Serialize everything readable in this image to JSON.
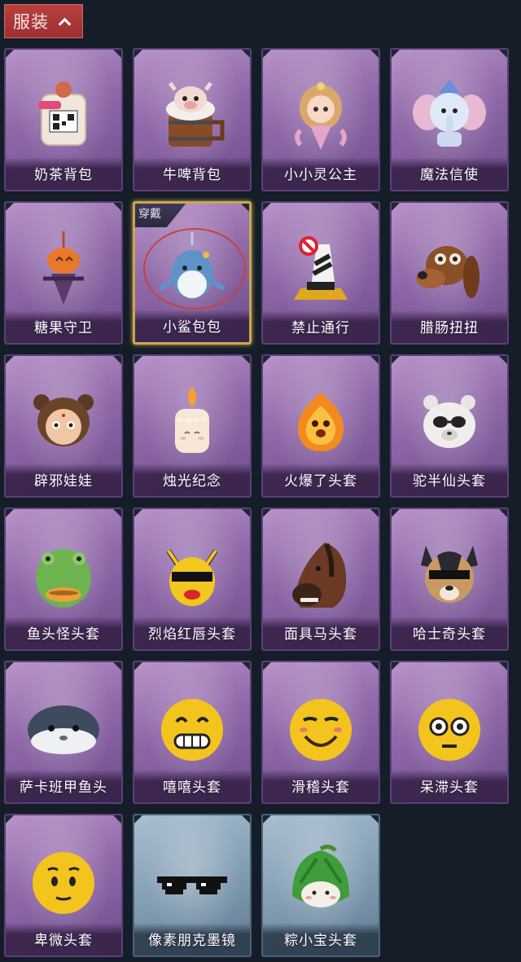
{
  "section": {
    "title": "服装",
    "expanded": true
  },
  "worn_badge": "穿戴",
  "items": [
    {
      "name": "奶茶背包",
      "icon": "milk-tea-backpack-icon",
      "rarity": "purple"
    },
    {
      "name": "牛啤背包",
      "icon": "beer-barrel-backpack-icon",
      "rarity": "purple"
    },
    {
      "name": "小小灵公主",
      "icon": "little-princess-icon",
      "rarity": "purple"
    },
    {
      "name": "魔法信使",
      "icon": "magic-elephant-icon",
      "rarity": "purple"
    },
    {
      "name": "糖果守卫",
      "icon": "pumpkin-guard-icon",
      "rarity": "purple"
    },
    {
      "name": "小鲨包包",
      "icon": "shark-bag-icon",
      "rarity": "purple",
      "worn": true
    },
    {
      "name": "禁止通行",
      "icon": "no-entry-sign-icon",
      "rarity": "purple"
    },
    {
      "name": "腊肠扭扭",
      "icon": "dachshund-icon",
      "rarity": "purple"
    },
    {
      "name": "辟邪娃娃",
      "icon": "doll-head-icon",
      "rarity": "purple"
    },
    {
      "name": "烛光纪念",
      "icon": "candle-icon",
      "rarity": "purple"
    },
    {
      "name": "火爆了头套",
      "icon": "fire-spirit-icon",
      "rarity": "purple"
    },
    {
      "name": "驼半仙头套",
      "icon": "alpaca-sunglasses-icon",
      "rarity": "purple"
    },
    {
      "name": "鱼头怪头套",
      "icon": "fish-head-icon",
      "rarity": "purple"
    },
    {
      "name": "烈焰红唇头套",
      "icon": "yellow-mask-icon",
      "rarity": "purple"
    },
    {
      "name": "面具马头套",
      "icon": "horse-mask-icon",
      "rarity": "purple"
    },
    {
      "name": "哈士奇头套",
      "icon": "husky-sunglasses-icon",
      "rarity": "purple"
    },
    {
      "name": "萨卡班甲鱼头",
      "icon": "sacabambaspis-icon",
      "rarity": "purple"
    },
    {
      "name": "嘻嘻头套",
      "icon": "grin-emoji-icon",
      "rarity": "purple"
    },
    {
      "name": "滑稽头套",
      "icon": "funny-emoji-icon",
      "rarity": "purple"
    },
    {
      "name": "呆滞头套",
      "icon": "dazed-emoji-icon",
      "rarity": "purple"
    },
    {
      "name": "卑微头套",
      "icon": "humble-emoji-icon",
      "rarity": "purple"
    },
    {
      "name": "像素朋克墨镜",
      "icon": "pixel-sunglasses-icon",
      "rarity": "blue"
    },
    {
      "name": "粽小宝头套",
      "icon": "zongzi-head-icon",
      "rarity": "blue"
    }
  ],
  "colors": {
    "background": "#141d28",
    "tab": "#a93637",
    "purple_rarity": "#8f68a8",
    "blue_rarity": "#839db3",
    "selected_frame": "#c9a651"
  }
}
